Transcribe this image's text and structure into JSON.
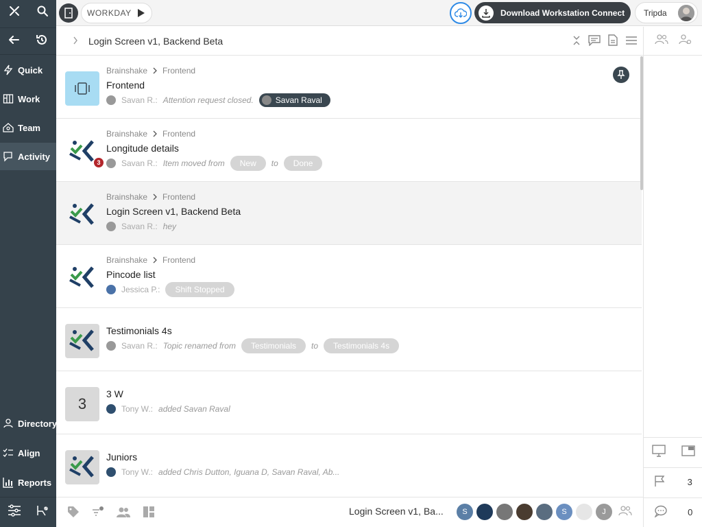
{
  "topbar": {
    "workday_label": "WORKDAY",
    "download_label": "Download Workstation Connect",
    "user_name": "Tripda"
  },
  "sidebar": {
    "items": [
      {
        "label": "Quick",
        "icon": "bolt-icon"
      },
      {
        "label": "Work",
        "icon": "board-icon"
      },
      {
        "label": "Team",
        "icon": "team-icon"
      },
      {
        "label": "Activity",
        "icon": "activity-icon",
        "active": true
      },
      {
        "label": "Directory",
        "icon": "directory-icon"
      },
      {
        "label": "Align",
        "icon": "align-icon"
      },
      {
        "label": "Reports",
        "icon": "reports-icon"
      }
    ]
  },
  "header": {
    "title": "Login Screen v1, Backend Beta"
  },
  "activity": [
    {
      "crumb1": "Brainshake",
      "crumb2": "Frontend",
      "title": "Frontend",
      "who": "Savan R.:",
      "text": "Attention request closed.",
      "pill": "Savan Raval"
    },
    {
      "crumb1": "Brainshake",
      "crumb2": "Frontend",
      "title": "Longitude details",
      "who": "Savan R.:",
      "text": "Item moved from",
      "from": "New",
      "to_word": "to",
      "to": "Done",
      "badge": "3"
    },
    {
      "crumb1": "Brainshake",
      "crumb2": "Frontend",
      "title": "Login Screen v1, Backend Beta",
      "who": "Savan R.:",
      "text": "hey"
    },
    {
      "crumb1": "Brainshake",
      "crumb2": "Frontend",
      "title": "Pincode list",
      "who": "Jessica P.:",
      "pill": "Shift Stopped"
    },
    {
      "title": "Testimonials 4s",
      "who": "Savan R.:",
      "text": "Topic renamed from",
      "from": "Testimonials",
      "to_word": "to",
      "to": "Testimonials 4s"
    },
    {
      "title": "3 W",
      "thumb_text": "3",
      "who": "Tony W.:",
      "text": "added Savan Raval"
    },
    {
      "title": "Juniors",
      "who": "Tony W.:",
      "text": "added Chris Dutton, Iguana D, Savan Raval, Ab..."
    }
  ],
  "bottombar": {
    "title": "Login Screen v1, Ba...",
    "avatars": [
      "S",
      "",
      "",
      "",
      "",
      "S",
      "",
      "J"
    ]
  },
  "rightpanel": {
    "flag_count": "3",
    "comment_count": "0"
  },
  "colors": {
    "sidebar_bg": "#35424b",
    "accent_blue": "#2e8ae6",
    "badge_red": "#b3262b",
    "logo_navy": "#1f3f66",
    "logo_green": "#3a9a4b"
  }
}
